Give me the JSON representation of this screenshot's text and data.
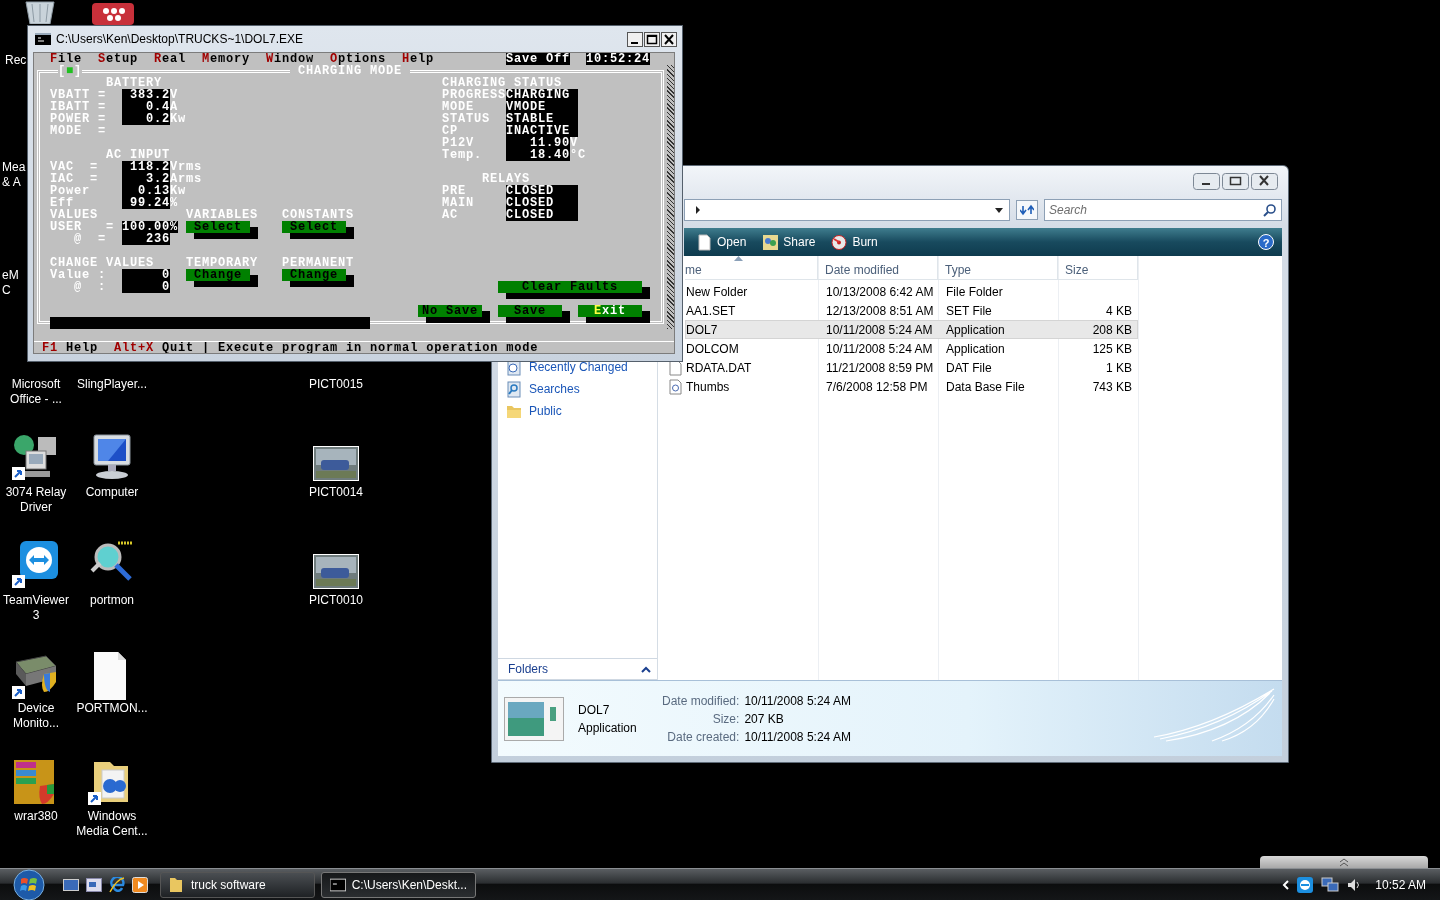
{
  "desktop_icons": [
    {
      "kind": "dice"
    },
    {
      "label": "Rec",
      "kind": "recycle",
      "shortcut": false
    },
    {
      "label": "Mea & A",
      "kind": "none"
    },
    {
      "label": "eM C",
      "kind": "none"
    },
    {
      "label": "Microsoft Office - ...",
      "kind": "none"
    },
    {
      "label": "SlingPlayer...",
      "kind": "none"
    },
    {
      "label": "PICT0015",
      "kind": "none"
    },
    {
      "label": "3074 Relay Driver",
      "kind": "network",
      "shortcut": true
    },
    {
      "label": "Computer",
      "kind": "computer",
      "shortcut": false
    },
    {
      "label": "PICT0014",
      "kind": "photo",
      "shortcut": false
    },
    {
      "label": "TeamViewer 3",
      "kind": "remote",
      "shortcut": true
    },
    {
      "label": "portmon",
      "kind": "magnifier",
      "shortcut": false
    },
    {
      "label": "PICT0010",
      "kind": "photo",
      "shortcut": false
    },
    {
      "label": "Device Monito...",
      "kind": "board",
      "shortcut": true
    },
    {
      "label": "PORTMON...",
      "kind": "document",
      "shortcut": false
    },
    {
      "label": "wrar380",
      "kind": "archive",
      "shortcut": false
    },
    {
      "label": "Windows Media Cent...",
      "kind": "folder",
      "shortcut": true
    }
  ],
  "explorer": {
    "search": {
      "placeholder": "Search"
    },
    "toolbar": [
      {
        "label": "Open",
        "kind": "page"
      },
      {
        "label": "Share",
        "kind": "share"
      },
      {
        "label": "Burn",
        "kind": "disc"
      }
    ],
    "help": "?",
    "nav": [
      {
        "label": "Recently Changed",
        "kind": "recent"
      },
      {
        "label": "Searches",
        "kind": "search"
      },
      {
        "label": "Public",
        "kind": "folder"
      }
    ],
    "folders_label": "Folders",
    "columns": [
      {
        "label": "me",
        "sorted": true
      },
      {
        "label": "Date modified",
        "sorted": false
      },
      {
        "label": "Type",
        "sorted": false
      },
      {
        "label": "Size",
        "sorted": false
      }
    ],
    "files": [
      {
        "name": "New Folder",
        "date": "10/13/2008 6:42 AM",
        "type": "File Folder",
        "selected": false
      },
      {
        "name": "AA1.SET",
        "date": "12/13/2008 8:51 AM",
        "type": "SET File",
        "size": "4 KB",
        "selected": false
      },
      {
        "name": "DOL7",
        "date": "10/11/2008 5:24 AM",
        "type": "Application",
        "size": "208 KB",
        "selected": true
      },
      {
        "name": "DOLCOM",
        "date": "10/11/2008 5:24 AM",
        "type": "Application",
        "size": "125 KB",
        "selected": false
      },
      {
        "name": "RDATA.DAT",
        "date": "11/21/2008 8:59 PM",
        "type": "DAT File",
        "size": "1 KB",
        "selected": false,
        "kind": "file"
      },
      {
        "name": "Thumbs",
        "date": "7/6/2008 12:58 PM",
        "type": "Data Base File",
        "size": "743 KB",
        "selected": false,
        "kind": "database"
      }
    ],
    "details": {
      "name": "DOL7",
      "type": "Application",
      "fields": [
        {
          "label": "Date modified:",
          "value": "10/11/2008 5:24 AM"
        },
        {
          "label": "Size:",
          "value": "207 KB"
        },
        {
          "label": "Date created:",
          "value": "10/11/2008 5:24 AM"
        }
      ]
    }
  },
  "console": {
    "title": "C:\\Users\\Ken\\Desktop\\TRUCKS~1\\DOL7.EXE",
    "menu": [
      "File",
      "Setup",
      "Real",
      "Memory",
      "Window",
      "Options",
      "Help"
    ],
    "save_indicator": "Save Off",
    "clock": "10:52:24",
    "frame_marker": "[■]",
    "mode_title": "CHARGING MODE",
    "battery": {
      "heading": "BATTERY",
      "rows": [
        {
          "label": "VBATT =",
          "value": "383.2",
          "unit": "V"
        },
        {
          "label": "IBATT =",
          "value": "0.4",
          "unit": "A"
        },
        {
          "label": "POWER =",
          "value": "0.2",
          "unit": "Kw"
        },
        {
          "label": "MODE  ="
        }
      ]
    },
    "ac_input": {
      "heading": "AC INPUT",
      "rows": [
        {
          "label": "VAC  =",
          "value": "118.2",
          "unit": "Vrms"
        },
        {
          "label": "IAC  =",
          "value": "3.2",
          "unit": "Arms"
        },
        {
          "label": "Power",
          "value": "0.13",
          "unit": "Kw"
        },
        {
          "label": "Eff",
          "value": "99.24",
          "unit": "%"
        }
      ]
    },
    "values": {
      "heading": "VALUES",
      "rows": [
        {
          "label": "USER   =",
          "value": "100.00%"
        },
        {
          "label": "@  =",
          "value": "236"
        }
      ]
    },
    "change_values": {
      "heading": "CHANGE VALUES",
      "rows": [
        {
          "label": "Value :",
          "value": "0"
        },
        {
          "label": "@  :",
          "value": "0"
        }
      ]
    },
    "actions": [
      {
        "heading": "VARIABLES",
        "button": "Select"
      },
      {
        "heading": "CONSTANTS",
        "button": "Select"
      },
      {
        "heading": "TEMPORARY",
        "button": "Change"
      },
      {
        "heading": "PERMANENT",
        "button": "Change"
      }
    ],
    "charging_status": {
      "heading": "CHARGING STATUS",
      "rows": [
        {
          "label": "PROGRESS",
          "value": "CHARGING"
        },
        {
          "label": "MODE",
          "value": "VMODE"
        },
        {
          "label": "STATUS",
          "value": "STABLE"
        },
        {
          "label": "CP",
          "value": "INACTIVE"
        },
        {
          "label": "P12V",
          "value": "11.90",
          "unit": "V"
        },
        {
          "label": "Temp.",
          "value": "18.40",
          "unit": "°C"
        }
      ]
    },
    "relays": {
      "heading": "RELAYS",
      "rows": [
        {
          "label": "PRE",
          "value": "CLOSED"
        },
        {
          "label": "MAIN",
          "value": "CLOSED"
        },
        {
          "label": "AC",
          "value": "CLOSED"
        }
      ]
    },
    "buttons": [
      {
        "label": "Clear Faults",
        "focused": false
      },
      {
        "label": "No Save",
        "focused": false
      },
      {
        "label": "Save",
        "focused": false
      },
      {
        "label": "Exit",
        "focused": true
      }
    ],
    "hints": [
      {
        "key": "F1",
        "label": "Help"
      },
      {
        "key": "Alt+X",
        "label": "Quit"
      }
    ],
    "message": "| Execute program in normal operation mode"
  },
  "taskbar": {
    "tasks": [
      {
        "label": "truck software",
        "kind": "folder",
        "selected": false
      },
      {
        "label": "C:\\Users\\Ken\\Deskt...",
        "kind": "console",
        "selected": true
      }
    ],
    "clock": "10:52 AM"
  }
}
